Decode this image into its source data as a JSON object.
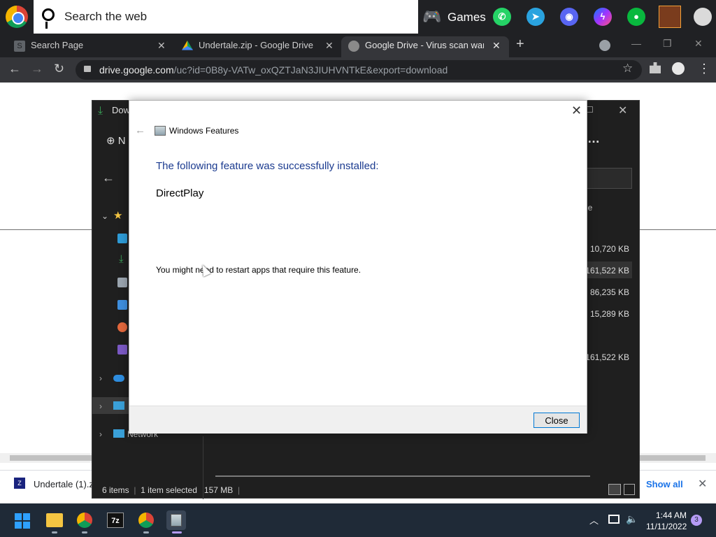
{
  "topbar": {
    "search_placeholder": "Search the web",
    "games_label": "Games",
    "apps": [
      "whatsapp",
      "telegram",
      "discord",
      "messenger",
      "wechat",
      "game-avatar",
      "extra"
    ]
  },
  "tabs": [
    {
      "title": "Search Page",
      "favicon": "S"
    },
    {
      "title": "Undertale.zip - Google Drive",
      "favicon": "google-drive-icon"
    },
    {
      "title": "Google Drive - Virus scan warnin",
      "favicon": "globe-icon"
    }
  ],
  "tab_close_glyph": "✕",
  "address": {
    "host": "drive.google.com",
    "path": "/uc?id=0B8y-VATw_oxQZTJaN3JIUHVNTkE&export=download"
  },
  "download_bar": {
    "file_name": "Undertale (1).z",
    "file_icon_label": "Z",
    "show_all": "Show all"
  },
  "explorer": {
    "title": "Dow",
    "new_label": "N",
    "size_header": "ize",
    "sizes": [
      "10,720 KB",
      "161,522 KB",
      "86,235 KB",
      "15,289 KB",
      "161,522 KB"
    ],
    "network_label": "Network",
    "status": {
      "items": "6 items",
      "selected": "1 item selected",
      "size": "157 MB"
    }
  },
  "dialog": {
    "title": "Windows Features",
    "heading": "The following feature was successfully installed:",
    "feature_name": "DirectPlay",
    "note": "You might need to restart apps that require this feature.",
    "close_button": "Close"
  },
  "taskbar": {
    "sevenzip_label": "7z",
    "time": "1:44 AM",
    "date": "11/11/2022",
    "notification_count": "3"
  },
  "colors": {
    "dialog_heading": "#1a3a8f",
    "button_focus": "#0078d4",
    "taskbar_bg": "#1f2a37"
  }
}
